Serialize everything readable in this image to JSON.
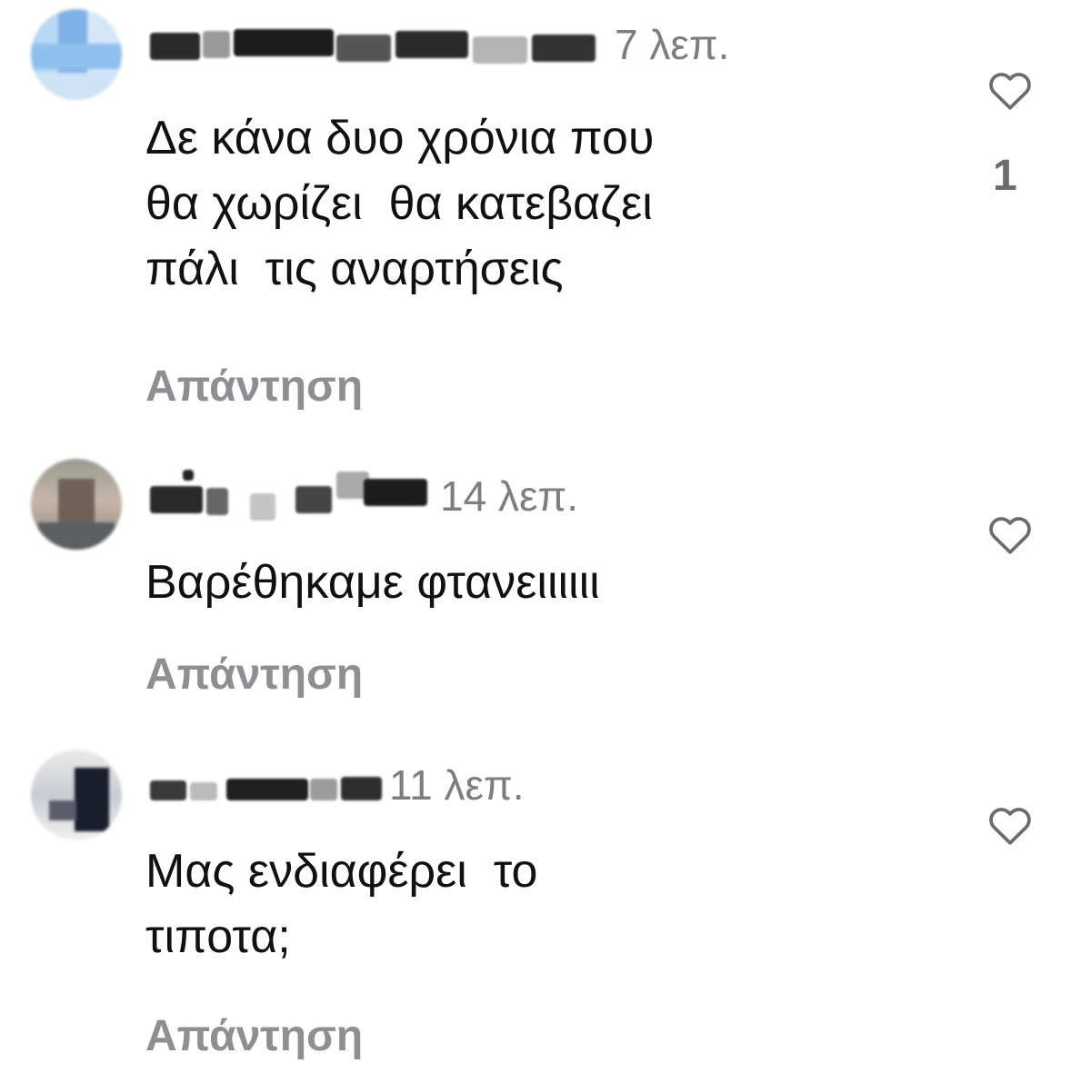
{
  "comments": [
    {
      "time": "7 λεπ.",
      "text": "Δε κάνα δυο χρόνια που\nθα χωρίζει  θα κατεβαζει\nπάλι  τις αναρτήσεις",
      "reply_label": "Απάντηση",
      "likes": "1",
      "heart_icon": "heart-outline-icon"
    },
    {
      "time": "14 λεπ.",
      "text": "Βαρέθηκαμε φτανειιιιιι",
      "reply_label": "Απάντηση",
      "heart_icon": "heart-outline-icon"
    },
    {
      "time": "11 λεπ.",
      "text": "Μας ενδιαφέρει  το\nτιποτα;",
      "reply_label": "Απάντηση",
      "heart_icon": "heart-outline-icon"
    }
  ],
  "colors": {
    "text": "#111111",
    "secondary": "#7d7d82",
    "reply": "#8e8e93",
    "heart": "#6b6b70"
  }
}
